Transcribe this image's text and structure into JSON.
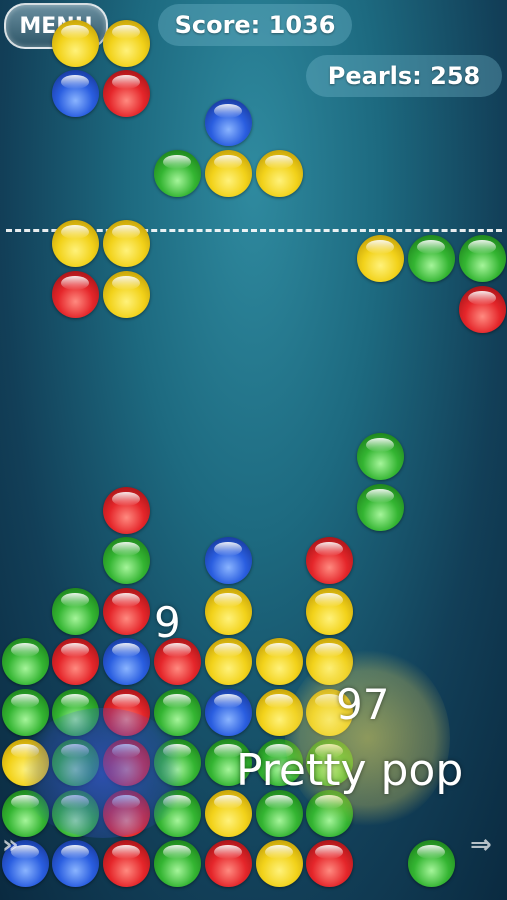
{
  "hud": {
    "menu_label": "MENU",
    "score_text": "Score: 1036",
    "pearls_text": "Pearls: 258"
  },
  "popup": {
    "count": "9",
    "points": "97",
    "message": "Pretty pop"
  },
  "colors": {
    "yellow": "#f2d21a",
    "red": "#e5262a",
    "blue": "#2a5ee0",
    "green": "#34b532"
  },
  "pieces": {
    "falling": [
      [
        "yellow",
        "yellow"
      ],
      [
        "blue",
        "red"
      ],
      [
        "blue"
      ],
      [
        "green",
        "yellow",
        "yellow"
      ]
    ],
    "next_left": [
      "yellow",
      "yellow",
      "red",
      "yellow"
    ],
    "next_right": [
      "yellow",
      "green",
      "green",
      "red"
    ],
    "dropping": [
      "green",
      "green"
    ]
  },
  "board": {
    "columns": [
      [
        "blue",
        "green",
        "yellow",
        "green",
        "green"
      ],
      [
        "blue",
        "green",
        "green",
        "green",
        "red",
        "green"
      ],
      [
        "red",
        "red",
        "red",
        "red",
        "blue",
        "red",
        "green",
        "red"
      ],
      [
        "green",
        "green",
        "green",
        "green",
        "red"
      ],
      [
        "red",
        "yellow",
        "green",
        "blue",
        "yellow",
        "yellow",
        "blue"
      ],
      [
        "yellow",
        "green",
        "green",
        "yellow",
        "yellow"
      ],
      [
        "red",
        "green",
        "green",
        "yellow",
        "yellow",
        "yellow",
        "red"
      ],
      [],
      [
        "green"
      ],
      []
    ]
  },
  "icons": {
    "left_arrow": "double-chevron-right-icon",
    "right_arrow": "arrow-right-icon"
  }
}
